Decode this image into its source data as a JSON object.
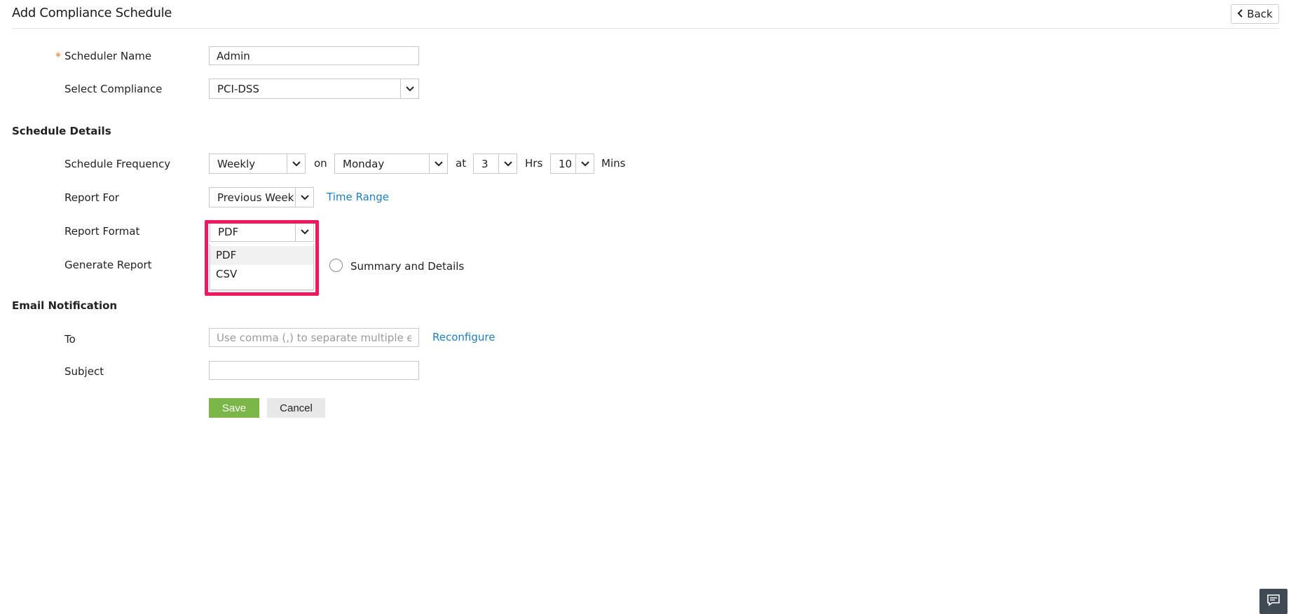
{
  "header": {
    "title": "Add Compliance Schedule",
    "back_label": "Back"
  },
  "form": {
    "scheduler_name": {
      "label": "Scheduler Name",
      "required_mark": "*",
      "value": "Admin"
    },
    "select_compliance": {
      "label": "Select Compliance",
      "value": "PCI-DSS"
    }
  },
  "schedule_details": {
    "title": "Schedule Details",
    "frequency": {
      "label": "Schedule Frequency",
      "value": "Weekly",
      "on_text": "on",
      "day_value": "Monday",
      "at_text": "at",
      "hour_value": "3",
      "hrs_text": "Hrs",
      "minute_value": "10",
      "mins_text": "Mins"
    },
    "report_for": {
      "label": "Report For",
      "value": "Previous Week",
      "time_range_link": "Time Range"
    },
    "report_format": {
      "label": "Report Format",
      "value": "PDF",
      "options": [
        "PDF",
        "CSV"
      ]
    },
    "generate_report": {
      "label": "Generate Report",
      "summary_details_label": "Summary and Details"
    }
  },
  "email_notification": {
    "title": "Email Notification",
    "to": {
      "label": "To",
      "placeholder": "Use comma (,) to separate multiple ema",
      "reconfigure_link": "Reconfigure"
    },
    "subject": {
      "label": "Subject",
      "value": ""
    }
  },
  "actions": {
    "save_label": "Save",
    "cancel_label": "Cancel"
  },
  "colors": {
    "accent_link": "#1f7ec2",
    "save_button": "#7ab648",
    "highlight": "#f0195f",
    "required": "#e07b1f"
  },
  "icons": {
    "back": "chevron-left-icon",
    "dropdown": "chevron-down-icon",
    "chat": "chat-icon"
  }
}
